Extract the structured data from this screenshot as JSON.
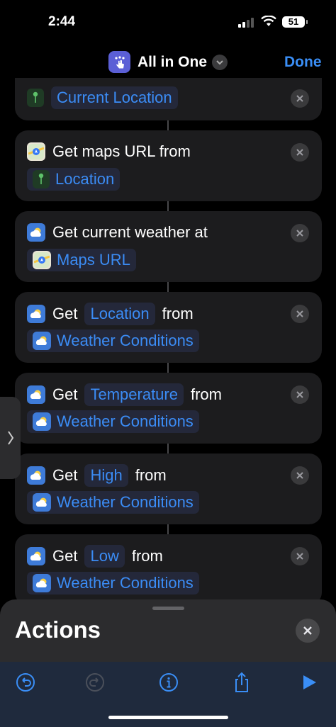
{
  "status_bar": {
    "time": "2:44",
    "battery": "51"
  },
  "nav": {
    "title": "All in One",
    "done_label": "Done"
  },
  "cards": [
    {
      "tokens": [
        "Current Location"
      ]
    },
    {
      "text": "Get maps URL from",
      "var": "Location"
    },
    {
      "text": "Get current weather at",
      "var": "Maps URL"
    },
    {
      "get": "Get",
      "prop": "Location",
      "from": "from",
      "var": "Weather Conditions"
    },
    {
      "get": "Get",
      "prop": "Temperature",
      "from": "from",
      "var": "Weather Conditions"
    },
    {
      "get": "Get",
      "prop": "High",
      "from": "from",
      "var": "Weather Conditions"
    },
    {
      "get": "Get",
      "prop": "Low",
      "from": "from",
      "var": "Weather Conditions"
    }
  ],
  "actions_sheet": {
    "title": "Actions"
  },
  "colors": {
    "accent": "#3a8ef6",
    "card": "#1c1c1e",
    "background": "#000000"
  },
  "icons": [
    "location-pin-icon",
    "maps-icon",
    "weather-icon",
    "close-icon",
    "undo-icon",
    "redo-icon",
    "info-icon",
    "share-icon",
    "play-icon"
  ]
}
